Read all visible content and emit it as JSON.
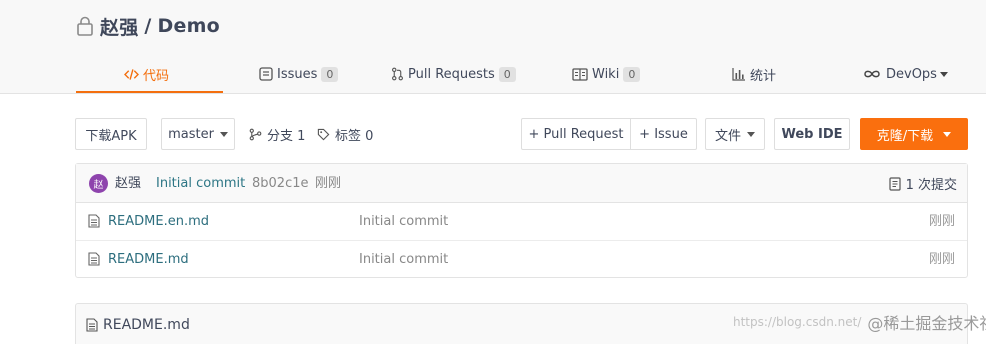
{
  "repo": {
    "owner": "赵强",
    "separator": "/",
    "name": "Demo"
  },
  "tabs": [
    {
      "label": "代码",
      "icon": "code-icon",
      "active": true
    },
    {
      "label": "Issues",
      "icon": "issues-icon",
      "count": "0"
    },
    {
      "label": "Pull Requests",
      "icon": "pull-request-icon",
      "count": "0"
    },
    {
      "label": "Wiki",
      "icon": "wiki-icon",
      "count": "0"
    },
    {
      "label": "统计",
      "icon": "stats-icon"
    },
    {
      "label": "DevOps",
      "icon": "devops-icon"
    }
  ],
  "toolbar": {
    "download_apk": "下载APK",
    "branch": "master",
    "branches": "分支 1",
    "tags": "标签 0",
    "new_pull_request": "+ Pull Request",
    "new_issue": "+ Issue",
    "files_menu": "文件",
    "web_ide": "Web IDE",
    "clone_download": "克隆/下载"
  },
  "latest_commit": {
    "avatar_text": "赵",
    "author": "赵强",
    "message": "Initial commit",
    "hash": "8b02c1e",
    "time": "刚刚",
    "commit_count": "1 次提交"
  },
  "files": [
    {
      "name": "README.en.md",
      "message": "Initial commit",
      "time": "刚刚"
    },
    {
      "name": "README.md",
      "message": "Initial commit",
      "time": "刚刚"
    }
  ],
  "readme": {
    "title": "README.md"
  },
  "watermark": {
    "url": "https://blog.csdn.net/",
    "brand": "@稀土掘金技术社区"
  },
  "colors": {
    "accent": "#f46f0e",
    "clone_button": "#fa6f0e",
    "link": "#2d6e7e",
    "avatar": "#8e44ad"
  }
}
